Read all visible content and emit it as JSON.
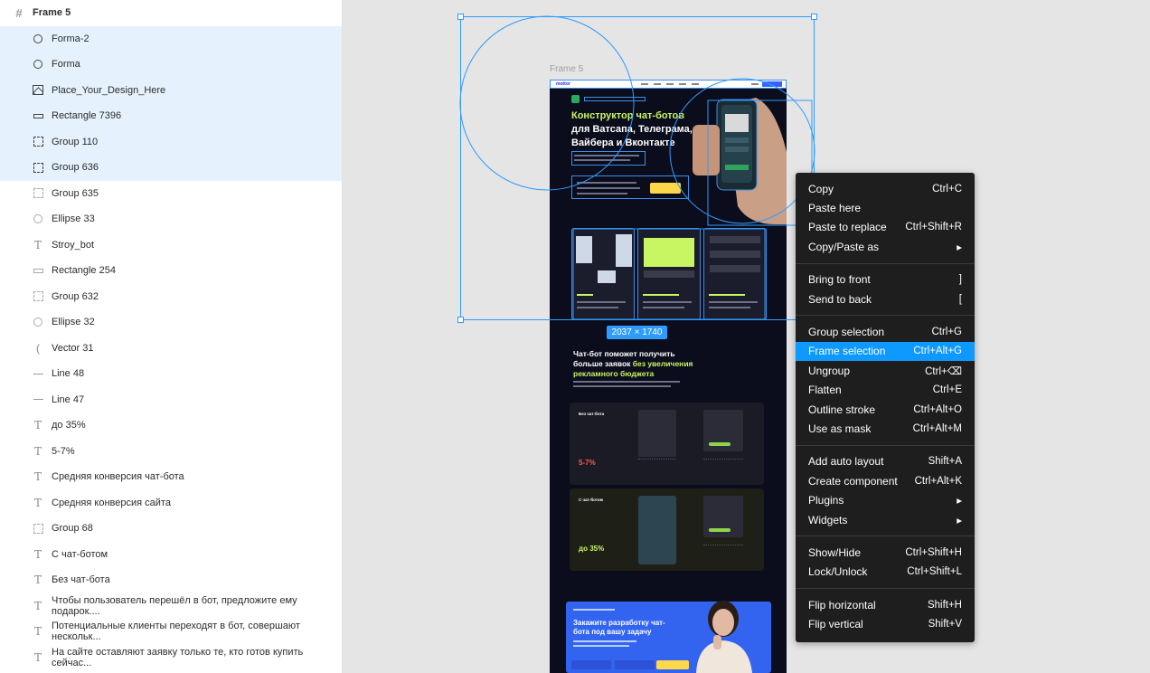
{
  "layers": {
    "root": {
      "label": "Frame 5",
      "icon": "frame-icon"
    },
    "items": [
      {
        "label": "Forma-2",
        "icon": "ellipse-icon",
        "selected": true
      },
      {
        "label": "Forma",
        "icon": "ellipse-icon",
        "selected": true
      },
      {
        "label": "Place_Your_Design_Here",
        "icon": "image-icon",
        "selected": true
      },
      {
        "label": "Rectangle 7396",
        "icon": "rectangle-icon",
        "selected": true
      },
      {
        "label": "Group 110",
        "icon": "group-icon",
        "selected": true
      },
      {
        "label": "Group 636",
        "icon": "group-icon",
        "selected": true
      },
      {
        "label": "Group 635",
        "icon": "group-icon",
        "selected": false
      },
      {
        "label": "Ellipse 33",
        "icon": "ellipse-icon",
        "selected": false
      },
      {
        "label": "Stroy_bot",
        "icon": "text-icon",
        "selected": false
      },
      {
        "label": "Rectangle 254",
        "icon": "rectangle-icon",
        "selected": false
      },
      {
        "label": "Group 632",
        "icon": "group-icon",
        "selected": false
      },
      {
        "label": "Ellipse 32",
        "icon": "ellipse-icon",
        "selected": false
      },
      {
        "label": "Vector 31",
        "icon": "vector-icon",
        "selected": false
      },
      {
        "label": "Line 48",
        "icon": "line-icon",
        "selected": false
      },
      {
        "label": "Line 47",
        "icon": "line-icon",
        "selected": false
      },
      {
        "label": "до 35%",
        "icon": "text-icon",
        "selected": false
      },
      {
        "label": "5-7%",
        "icon": "text-icon",
        "selected": false
      },
      {
        "label": "Средняя конверсия чат-бота",
        "icon": "text-icon",
        "selected": false
      },
      {
        "label": "Средняя конверсия сайта",
        "icon": "text-icon",
        "selected": false
      },
      {
        "label": "Group 68",
        "icon": "group-icon",
        "selected": false
      },
      {
        "label": "С чат-ботом",
        "icon": "text-icon",
        "selected": false
      },
      {
        "label": "Без чат-бота",
        "icon": "text-icon",
        "selected": false
      },
      {
        "label": "Чтобы пользователь перешёл в бот, предложите ему подарок....",
        "icon": "text-icon",
        "selected": false
      },
      {
        "label": "Потенциальные клиенты переходят в бот, совершают нескольк...",
        "icon": "text-icon",
        "selected": false
      },
      {
        "label": "На сайте оставляют заявку только те, кто готов купить сейчас...",
        "icon": "text-icon",
        "selected": false
      }
    ]
  },
  "canvas": {
    "frame_label": "Frame 5",
    "size_badge": "2037 × 1740",
    "preview": {
      "logo": "mottor",
      "hero_title_line1": "Конструктор чат-ботов",
      "hero_title_line2": "для Ватсапа, Телеграма,",
      "hero_title_line3": "Вайбера и Вконтакте",
      "section2_line1": "Чат-бот поможет получить",
      "section2_line2": "больше заявок",
      "section2_accent": "без увеличения",
      "section2_line3": "рекламного бюджета",
      "block1_title": "Без чат-бота",
      "block1_pct": "5-7%",
      "block2_title": "С чат-ботом",
      "block2_pct": "до 35%",
      "promo_title": "Закажите разработку чат-бота под вашу задачу"
    }
  },
  "context_menu": {
    "groups": [
      [
        {
          "label": "Copy",
          "shortcut": "Ctrl+C"
        },
        {
          "label": "Paste here",
          "shortcut": ""
        },
        {
          "label": "Paste to replace",
          "shortcut": "Ctrl+Shift+R"
        },
        {
          "label": "Copy/Paste as",
          "shortcut": "▸"
        }
      ],
      [
        {
          "label": "Bring to front",
          "shortcut": "]"
        },
        {
          "label": "Send to back",
          "shortcut": "["
        }
      ],
      [
        {
          "label": "Group selection",
          "shortcut": "Ctrl+G"
        },
        {
          "label": "Frame selection",
          "shortcut": "Ctrl+Alt+G",
          "active": true
        },
        {
          "label": "Ungroup",
          "shortcut": "Ctrl+⌫"
        },
        {
          "label": "Flatten",
          "shortcut": "Ctrl+E"
        },
        {
          "label": "Outline stroke",
          "shortcut": "Ctrl+Alt+O"
        },
        {
          "label": "Use as mask",
          "shortcut": "Ctrl+Alt+M"
        }
      ],
      [
        {
          "label": "Add auto layout",
          "shortcut": "Shift+A"
        },
        {
          "label": "Create component",
          "shortcut": "Ctrl+Alt+K"
        },
        {
          "label": "Plugins",
          "shortcut": "▸"
        },
        {
          "label": "Widgets",
          "shortcut": "▸"
        }
      ],
      [
        {
          "label": "Show/Hide",
          "shortcut": "Ctrl+Shift+H"
        },
        {
          "label": "Lock/Unlock",
          "shortcut": "Ctrl+Shift+L"
        }
      ],
      [
        {
          "label": "Flip horizontal",
          "shortcut": "Shift+H"
        },
        {
          "label": "Flip vertical",
          "shortcut": "Shift+V"
        }
      ]
    ]
  },
  "colors": {
    "selection": "#2e9bff",
    "menu_bg": "#1e1e1e",
    "menu_active": "#0d99ff",
    "layer_selected_bg": "#e5f1fc",
    "accent_green": "#c8f562"
  }
}
